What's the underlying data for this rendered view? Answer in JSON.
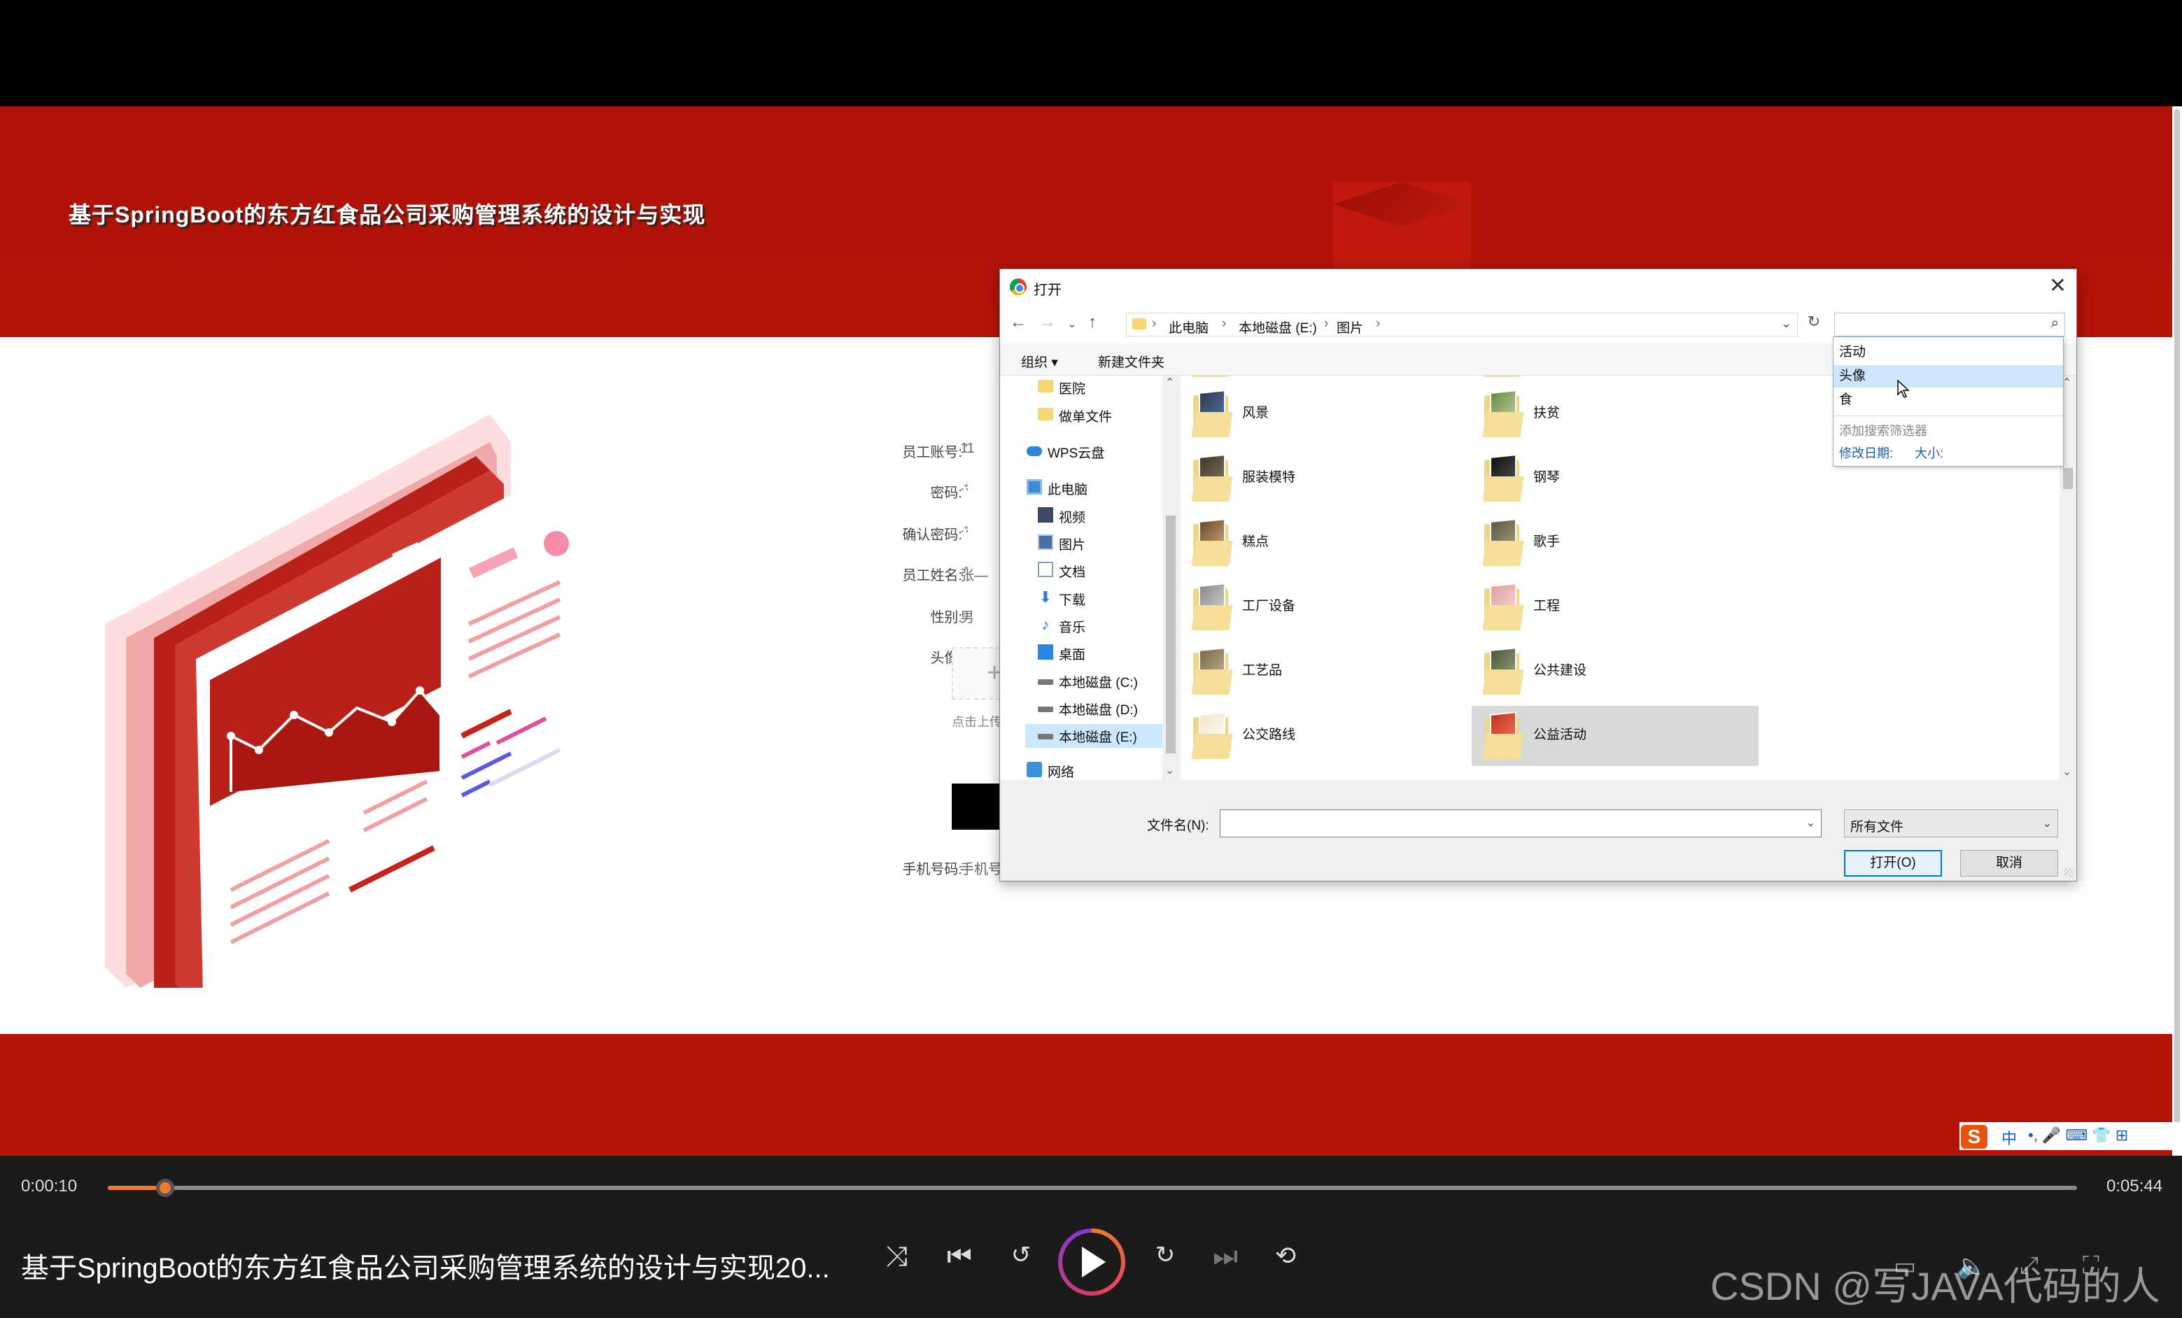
{
  "video": {
    "hero_title": "基于SpringBoot的东方红食品公司采购管理系统的设计与实现"
  },
  "register_form": {
    "rows": [
      {
        "label": "员工账号:",
        "value": "11",
        "required": true
      },
      {
        "label": "密码:",
        "value": "··",
        "required": true
      },
      {
        "label": "确认密码:",
        "value": "··",
        "required": true
      },
      {
        "label": "员工姓名:",
        "value": "张—",
        "required": true
      },
      {
        "label": "性别:",
        "value": "男",
        "required": false
      },
      {
        "label": "头像:",
        "value": "",
        "required": false
      }
    ],
    "upload_hint": "点击上传",
    "phone_label": "手机号码:",
    "phone_placeholder": "手机号"
  },
  "dialog": {
    "title": "打开",
    "breadcrumbs": [
      "此电脑",
      "本地磁盘 (E:)",
      "图片"
    ],
    "toolbar": {
      "organize": "组织 ▾",
      "new_folder": "新建文件夹"
    },
    "nav_items": [
      {
        "label": "医院",
        "icon": "folder-icon"
      },
      {
        "label": "做单文件",
        "icon": "folder-icon"
      },
      {
        "label": "WPS云盘",
        "icon": "cloud-icon"
      },
      {
        "label": "此电脑",
        "icon": "computer-icon"
      },
      {
        "label": "视频",
        "icon": "video-icon"
      },
      {
        "label": "图片",
        "icon": "picture-icon"
      },
      {
        "label": "文档",
        "icon": "document-icon"
      },
      {
        "label": "下载",
        "icon": "download-icon"
      },
      {
        "label": "音乐",
        "icon": "music-icon"
      },
      {
        "label": "桌面",
        "icon": "desktop-icon"
      },
      {
        "label": "本地磁盘 (C:)",
        "icon": "disk-icon"
      },
      {
        "label": "本地磁盘 (D:)",
        "icon": "disk-icon"
      },
      {
        "label": "本地磁盘 (E:)",
        "icon": "disk-icon",
        "selected": true
      },
      {
        "label": "网络",
        "icon": "network-icon"
      }
    ],
    "files": [
      {
        "name": "风景"
      },
      {
        "name": "扶贫"
      },
      {
        "name": "服装模特"
      },
      {
        "name": "钢琴"
      },
      {
        "name": "糕点"
      },
      {
        "name": "歌手"
      },
      {
        "name": "工厂设备"
      },
      {
        "name": "工程"
      },
      {
        "name": "工艺品"
      },
      {
        "name": "公共建设"
      },
      {
        "name": "公交路线"
      },
      {
        "name": "公益活动",
        "selected": true
      }
    ],
    "search_suggestions": [
      "活动",
      "头像",
      "食"
    ],
    "search_hint": "添加搜索筛选器",
    "search_filters": [
      "修改日期:",
      "大小:"
    ],
    "filename_label": "文件名(N):",
    "filename_value": "",
    "filetype": "所有文件",
    "open_button": "打开(O)",
    "cancel_button": "取消"
  },
  "ime": {
    "lang": "中",
    "symbols": "•, 🎤 ⌨ 👕 ⊞"
  },
  "player": {
    "current_time": "0:00:10",
    "total_time": "0:05:44",
    "progress": 0.029,
    "title": "基于SpringBoot的东方红食品公司采购管理系统的设计与实现20...",
    "watermark": "CSDN @写JAVA代码的人"
  },
  "colors": {
    "brand_red": "#b41408",
    "accent_orange": "#f07a30"
  }
}
